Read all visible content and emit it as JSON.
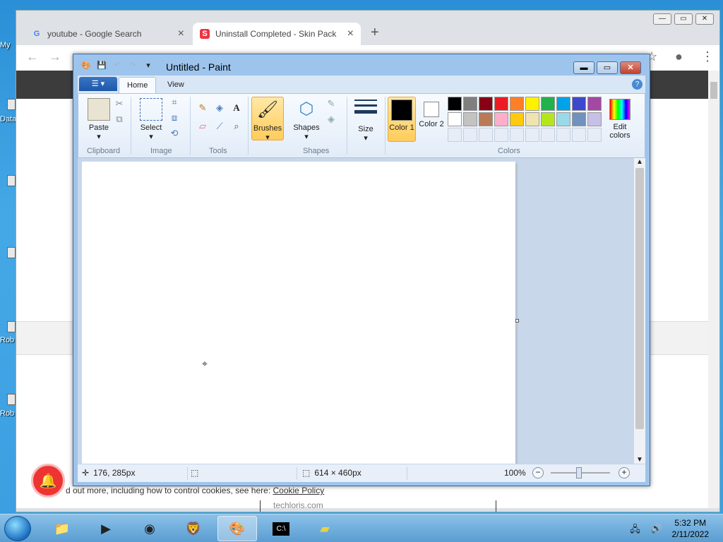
{
  "desktop": {
    "labels": [
      "My",
      "Data",
      "Rob",
      "Rob"
    ]
  },
  "browser": {
    "tabs": [
      {
        "title": "youtube - Google Search",
        "favicon": "google-icon"
      },
      {
        "title": "Uninstall Completed - Skin Pack",
        "favicon": "skinpack-icon"
      }
    ],
    "new_tab": "+",
    "back": "←",
    "forward": "→",
    "cookie_prefix": "d out more, including how to control cookies, see here: ",
    "cookie_link": "Cookie Policy",
    "footer_site": "techloris.com",
    "window_buttons": [
      "—",
      "▭",
      "✕"
    ]
  },
  "paint": {
    "title": "Untitled - Paint",
    "title_buttons": [
      "▬",
      "▭",
      "✕"
    ],
    "tabs": [
      "Home",
      "View"
    ],
    "groups": [
      "Clipboard",
      "Image",
      "Tools",
      "Shapes",
      "Colors"
    ],
    "buttons": {
      "paste": "Paste",
      "select": "Select",
      "brushes": "Brushes",
      "shapes": "Shapes",
      "size": "Size",
      "color1": "Color 1",
      "color2": "Color 2",
      "edit_colors": "Edit colors"
    },
    "palette_row1": [
      "#000000",
      "#7f7f7f",
      "#880015",
      "#ed1c24",
      "#ff7f27",
      "#fff200",
      "#22b14c",
      "#00a2e8",
      "#3f48cc",
      "#a349a4"
    ],
    "palette_row2": [
      "#ffffff",
      "#c3c3c3",
      "#b97a57",
      "#ffaec9",
      "#ffc90e",
      "#efe4b0",
      "#b5e61d",
      "#99d9ea",
      "#7092be",
      "#c8bfe7"
    ],
    "color1_value": "#000000",
    "color2_value": "#ffffff",
    "status": {
      "cursor_pos": "176, 285px",
      "canvas_size": "614 × 460px",
      "zoom": "100%"
    }
  },
  "taskbar": {
    "time": "5:32 PM",
    "date": "2/11/2022",
    "apps": [
      "explorer-icon",
      "media-player-icon",
      "chrome-icon",
      "brave-icon",
      "paint-icon",
      "cmd-icon",
      "sticky-notes-icon"
    ]
  }
}
